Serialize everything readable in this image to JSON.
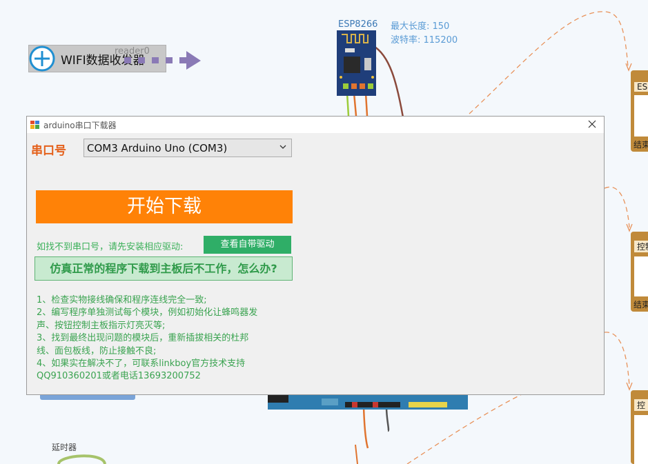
{
  "canvas": {
    "wifi_block": {
      "label": "WIFI数据收发器",
      "ghost_label": "reader0"
    },
    "esp_module": {
      "name": "ESP8266",
      "max_length": "最大长度: 150",
      "baud_rate": "波特率: 115200"
    },
    "delay_label": "延时器",
    "side_cards": [
      {
        "tag": "ESP",
        "end": "结束"
      },
      {
        "tag": "控制",
        "end": "结束"
      },
      {
        "tag": "控",
        "end": ""
      }
    ]
  },
  "dialog": {
    "title": "arduino串口下载器",
    "port_label": "串口号",
    "port_value": "COM3 Arduino Uno (COM3)",
    "start_button": "开始下载",
    "driver_hint": "如找不到串口号，请先安装相应驱动:",
    "driver_button": "查看自带驱动",
    "faq_button": "仿真正常的程序下载到主板后不工作，怎么办?",
    "steps": [
      "1、检查实物接线确保和程序连线完全一致;",
      "2、编写程序单独测试每个模块，例如初始化让蜂鸣器发",
      "声、按钮控制主板指示灯亮灭等;",
      "3、找到最终出现问题的模块后，重新插拔相关的杜邦",
      "线、面包板线，防止接触不良;",
      "4、如果实在解决不了，可联系linkboy官方技术支持",
      "QQ910360201或者电话13693200752"
    ]
  },
  "colors": {
    "accent_orange": "#ff8207",
    "port_label": "#e4601a",
    "green_text": "#3aa350",
    "green_button": "#2fae67",
    "card_brown": "#c08a3a"
  }
}
